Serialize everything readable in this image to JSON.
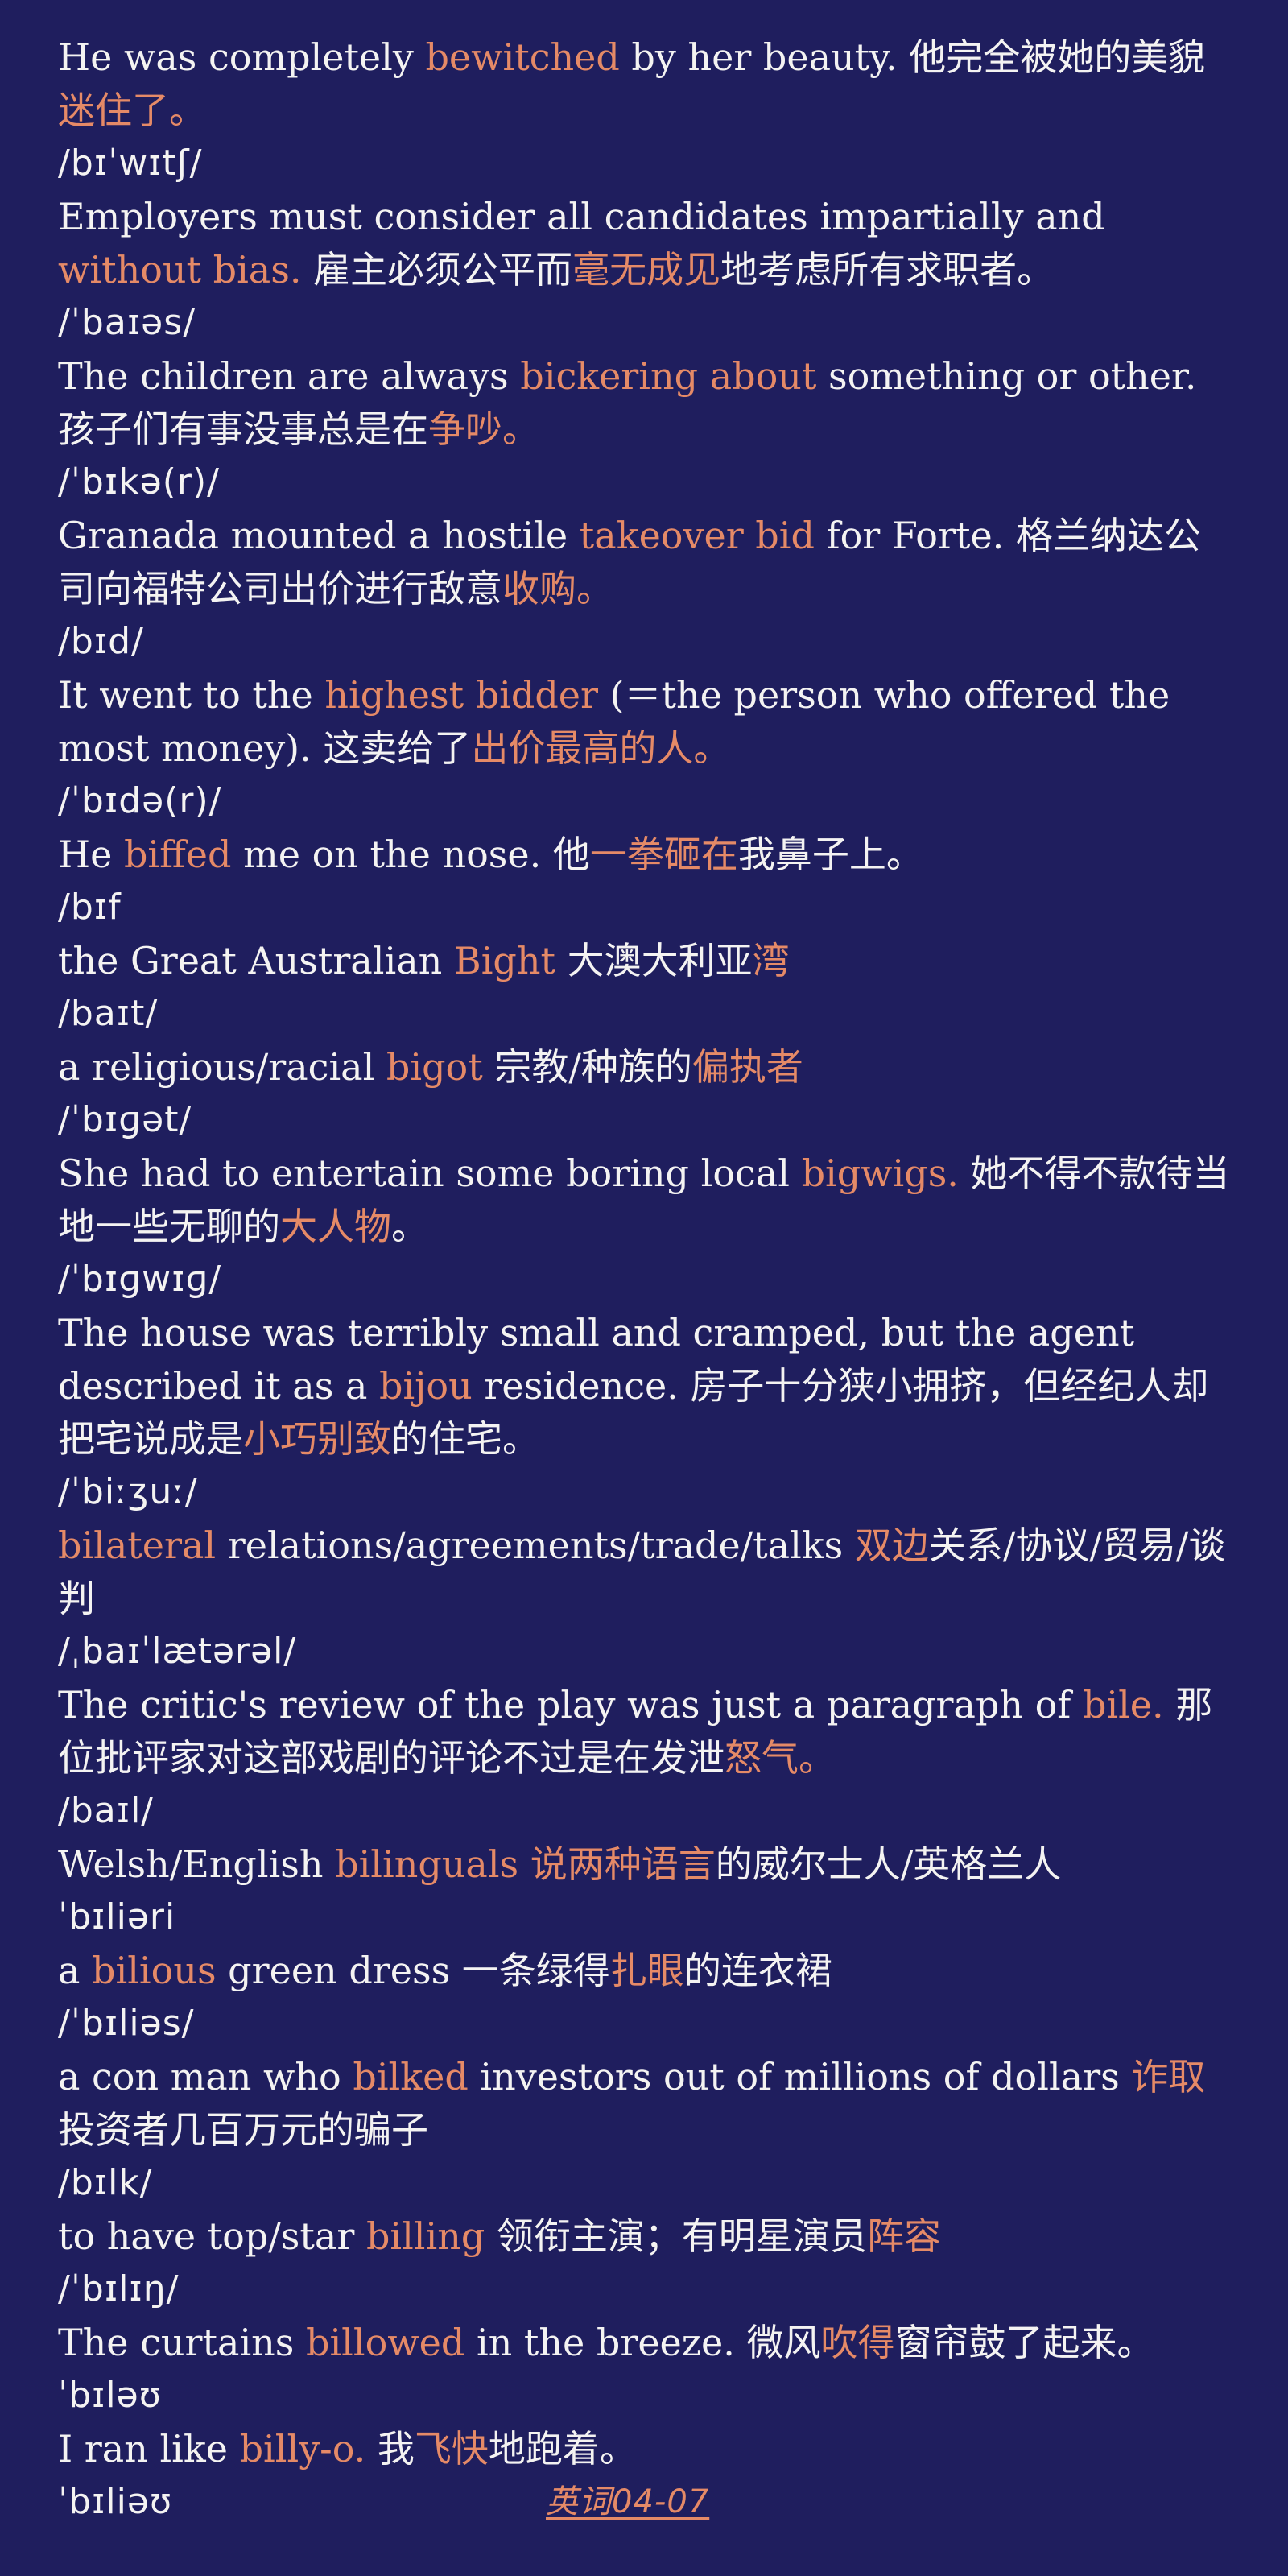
{
  "entries": [
    {
      "sentence": [
        {
          "t": "He was completely "
        },
        {
          "t": "bewitched",
          "hl": true
        },
        {
          "t": " by her beauty. 他完全被她的美貌"
        },
        {
          "t": "迷住了",
          "hl": true
        },
        {
          "t": "。",
          "hl": true
        }
      ],
      "phonetic": "/bɪˈwɪtʃ/"
    },
    {
      "sentence": [
        {
          "t": "Employers must consider all candidates impartially and "
        },
        {
          "t": "without bias.",
          "hl": true
        },
        {
          "t": " 雇主必须公平而"
        },
        {
          "t": "毫无成见",
          "hl": true
        },
        {
          "t": "地考虑所有求职者。"
        }
      ],
      "phonetic": "/ˈbaɪəs/"
    },
    {
      "sentence": [
        {
          "t": "The children are always "
        },
        {
          "t": "bickering about",
          "hl": true
        },
        {
          "t": " something or other. 孩子们有事没事总是在"
        },
        {
          "t": "争吵",
          "hl": true
        },
        {
          "t": "。",
          "hl": true
        }
      ],
      "phonetic": "/ˈbɪkə(r)/"
    },
    {
      "sentence": [
        {
          "t": "Granada mounted a hostile "
        },
        {
          "t": "takeover bid",
          "hl": true
        },
        {
          "t": " for Forte. 格兰纳达公司向福特公司出价进行敌意"
        },
        {
          "t": "收购",
          "hl": true
        },
        {
          "t": "。",
          "hl": true
        }
      ],
      "phonetic": "/bɪd/"
    },
    {
      "sentence": [
        {
          "t": "It went to the "
        },
        {
          "t": "highest bidder",
          "hl": true
        },
        {
          "t": " (＝the person who offered the most money). 这卖给了"
        },
        {
          "t": "出价最高的人",
          "hl": true
        },
        {
          "t": "。",
          "hl": true
        }
      ],
      "phonetic": "/ˈbɪdə(r)/"
    },
    {
      "sentence": [
        {
          "t": "He "
        },
        {
          "t": "biffed",
          "hl": true
        },
        {
          "t": " me on the nose. 他"
        },
        {
          "t": "一拳砸在",
          "hl": true
        },
        {
          "t": "我鼻子上。"
        }
      ],
      "phonetic": "/bɪf"
    },
    {
      "sentence": [
        {
          "t": "the Great Australian "
        },
        {
          "t": "Bight",
          "hl": true
        },
        {
          "t": " 大澳大利亚"
        },
        {
          "t": "湾",
          "hl": true
        }
      ],
      "phonetic": "/baɪt/"
    },
    {
      "sentence": [
        {
          "t": "a religious/racial "
        },
        {
          "t": "bigot",
          "hl": true
        },
        {
          "t": " 宗教/种族的"
        },
        {
          "t": "偏执者",
          "hl": true
        }
      ],
      "phonetic": "/ˈbɪɡət/"
    },
    {
      "sentence": [
        {
          "t": "She had to entertain some boring local "
        },
        {
          "t": "bigwigs.",
          "hl": true
        },
        {
          "t": " 她不得不款待当地一些无聊的"
        },
        {
          "t": "大人物",
          "hl": true
        },
        {
          "t": "。"
        }
      ],
      "phonetic": "/ˈbɪɡwɪɡ/"
    },
    {
      "sentence": [
        {
          "t": "The house was terribly small and cramped, but the agent described it as a "
        },
        {
          "t": "bijou",
          "hl": true
        },
        {
          "t": " residence. 房子十分狭小拥挤，但经纪人却把宅说成是"
        },
        {
          "t": "小巧别致",
          "hl": true
        },
        {
          "t": "的住宅。"
        }
      ],
      "phonetic": "/ˈbiːʒuː/"
    },
    {
      "sentence": [
        {
          "t": "bilateral",
          "hl": true
        },
        {
          "t": " relations/agreements/trade/talks "
        },
        {
          "t": "双边",
          "hl": true
        },
        {
          "t": "关系/协议/贸易/谈判"
        }
      ],
      "phonetic": "/ˌbaɪˈlætərəl/"
    },
    {
      "sentence": [
        {
          "t": "The critic's review of the play was just a paragraph of "
        },
        {
          "t": "bile.",
          "hl": true
        },
        {
          "t": " 那位批评家对这部戏剧的评论不过是在发泄"
        },
        {
          "t": "怒气",
          "hl": true
        },
        {
          "t": "。",
          "hl": true
        }
      ],
      "phonetic": "/baɪl/"
    },
    {
      "sentence": [
        {
          "t": "Welsh/English "
        },
        {
          "t": "bilinguals",
          "hl": true
        },
        {
          "t": " "
        },
        {
          "t": "说两种语言",
          "hl": true
        },
        {
          "t": "的威尔士人/英格兰人"
        }
      ],
      "phonetic": "ˈbɪliəri"
    },
    {
      "sentence": [
        {
          "t": "a "
        },
        {
          "t": "bilious",
          "hl": true
        },
        {
          "t": " green dress 一条绿得"
        },
        {
          "t": "扎眼",
          "hl": true
        },
        {
          "t": "的连衣裙"
        }
      ],
      "phonetic": "/ˈbɪliəs/"
    },
    {
      "sentence": [
        {
          "t": "a con man who "
        },
        {
          "t": "bilked",
          "hl": true
        },
        {
          "t": " investors out of millions of dollars "
        },
        {
          "t": "诈取",
          "hl": true
        },
        {
          "t": "投资者几百万元的骗子"
        }
      ],
      "phonetic": "/bɪlk/"
    },
    {
      "sentence": [
        {
          "t": "to have top/star "
        },
        {
          "t": "billing",
          "hl": true
        },
        {
          "t": " 领衔主演；有明星演员"
        },
        {
          "t": "阵容",
          "hl": true
        }
      ],
      "phonetic": "/ˈbɪlɪŋ/"
    },
    {
      "sentence": [
        {
          "t": "The curtains "
        },
        {
          "t": "billowed",
          "hl": true
        },
        {
          "t": " in the breeze. 微风"
        },
        {
          "t": "吹得",
          "hl": true
        },
        {
          "t": "窗帘鼓了起来。"
        }
      ],
      "phonetic": "ˈbɪləʊ"
    },
    {
      "sentence": [
        {
          "t": "I ran like "
        },
        {
          "t": "billy-o.",
          "hl": true
        },
        {
          "t": " 我"
        },
        {
          "t": "飞快",
          "hl": true
        },
        {
          "t": "地跑着。"
        }
      ],
      "phonetic": "ˈbɪliəʊ"
    }
  ],
  "footer": {
    "link_label": "英词04-07"
  },
  "colors": {
    "background": "#1f1e5e",
    "text": "#f4f3f2",
    "highlight": "#e58a67"
  }
}
